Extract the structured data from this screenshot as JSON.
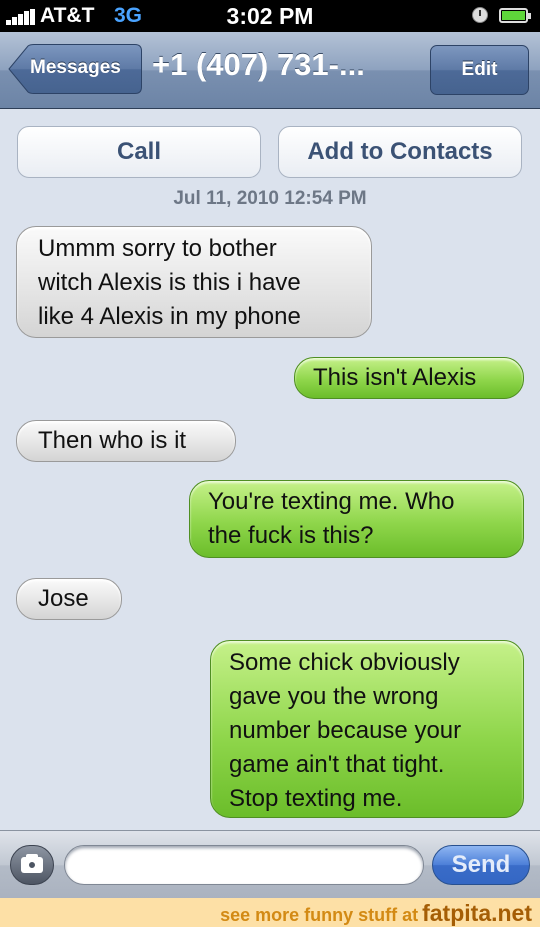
{
  "status_bar": {
    "carrier": "AT&T",
    "network": "3G",
    "time": "3:02 PM"
  },
  "nav": {
    "back_label": "Messages",
    "title": "+1 (407) 731-...",
    "edit_label": "Edit"
  },
  "actions": {
    "call_label": "Call",
    "add_contact_label": "Add to Contacts"
  },
  "timestamp": "Jul 11, 2010 12:54 PM",
  "messages": [
    {
      "direction": "incoming",
      "lines": [
        "Ummm sorry to bother",
        "witch Alexis is this i have",
        "like 4 Alexis in my phone"
      ]
    },
    {
      "direction": "outgoing",
      "lines": [
        "This isn't Alexis"
      ]
    },
    {
      "direction": "incoming",
      "lines": [
        "Then who is it"
      ]
    },
    {
      "direction": "outgoing",
      "lines": [
        "You're texting me. Who",
        "the fuck is this?"
      ]
    },
    {
      "direction": "incoming",
      "lines": [
        "Jose"
      ]
    },
    {
      "direction": "outgoing",
      "lines": [
        "Some chick obviously",
        "gave you the wrong",
        "number because your",
        "game ain't that tight.",
        "Stop texting me."
      ]
    }
  ],
  "input_bar": {
    "message_value": "",
    "send_label": "Send"
  },
  "footer": {
    "prefix": "see more funny stuff at",
    "brand": "fatpita.net"
  },
  "colors": {
    "background": "#dbe2ed",
    "incoming_bubble": "#e6e6e6",
    "outgoing_bubble": "#8fd64b",
    "footer_background": "#fde0a6"
  },
  "icons": {
    "signal": "signal-bars-icon",
    "clock": "clock-icon",
    "battery": "battery-icon",
    "camera": "camera-icon"
  }
}
